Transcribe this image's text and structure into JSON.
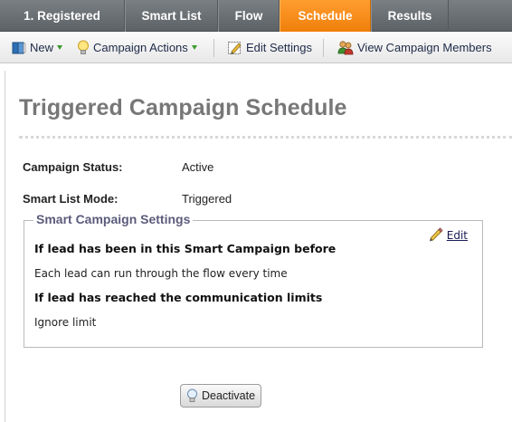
{
  "tabs": [
    {
      "label": "1. Registered",
      "active": false
    },
    {
      "label": "Smart List",
      "active": false
    },
    {
      "label": "Flow",
      "active": false
    },
    {
      "label": "Schedule",
      "active": true
    },
    {
      "label": "Results",
      "active": false
    }
  ],
  "toolbar": {
    "new_label": "New",
    "campaign_actions_label": "Campaign Actions",
    "edit_settings_label": "Edit Settings",
    "view_members_label": "View Campaign Members"
  },
  "page": {
    "title": "Triggered Campaign Schedule",
    "fields": [
      {
        "label": "Campaign Status:",
        "value": "Active"
      },
      {
        "label": "Smart List Mode:",
        "value": "Triggered"
      }
    ]
  },
  "settings": {
    "legend": "Smart Campaign Settings",
    "edit_label": "Edit",
    "heading_1": "If lead has been in this Smart Campaign before",
    "text_1": "Each lead can run through the flow every time",
    "heading_2": "If lead has reached the communication limits",
    "text_2": "Ignore limit"
  },
  "deactivate_label": "Deactivate",
  "colors": {
    "active_tab": "#f58a1f",
    "tabbar": "#6b7074",
    "title": "#777777",
    "legend": "#5b5b7c"
  }
}
